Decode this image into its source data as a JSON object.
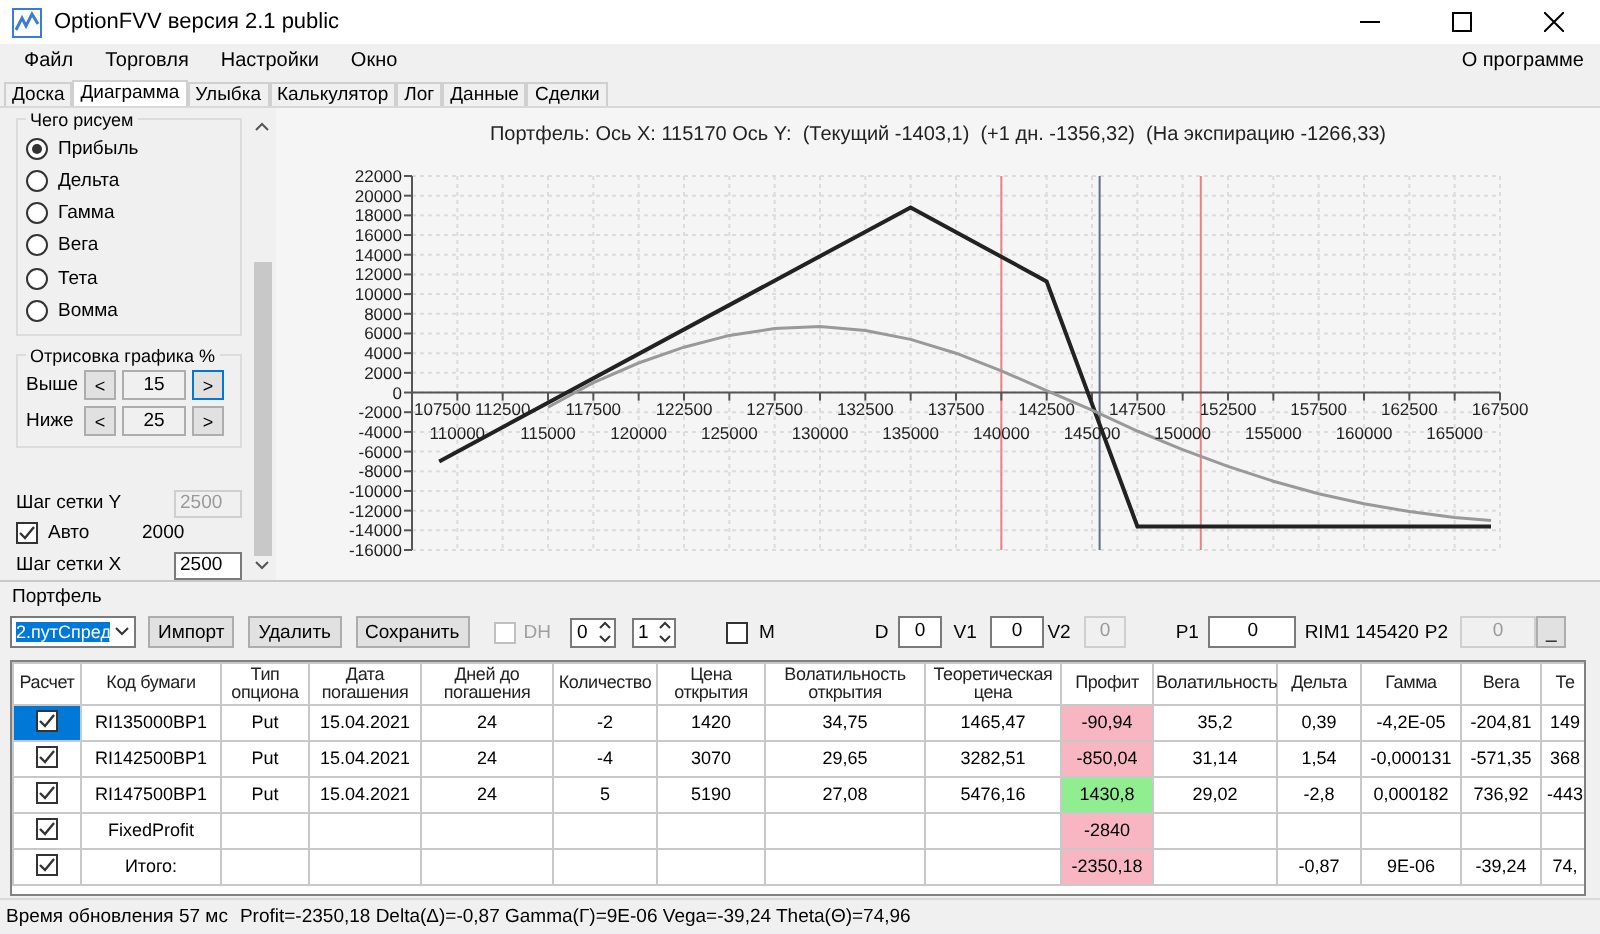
{
  "window": {
    "title": "OptionFVV версия 2.1 public"
  },
  "menu": [
    {
      "label": "Файл"
    },
    {
      "label": "Торговля"
    },
    {
      "label": "Настройки"
    },
    {
      "label": "Окно"
    }
  ],
  "menu_right": "О программе",
  "tabs": [
    {
      "label": "Доска",
      "selected": false
    },
    {
      "label": "Диаграмма",
      "selected": true
    },
    {
      "label": "Улыбка",
      "selected": false
    },
    {
      "label": "Калькулятор",
      "selected": false
    },
    {
      "label": "Лог",
      "selected": false
    },
    {
      "label": "Данные",
      "selected": false
    },
    {
      "label": "Сделки",
      "selected": false
    }
  ],
  "left_panel": {
    "draw_group": {
      "title": "Чего рисуем",
      "options": [
        {
          "label": "Прибыль",
          "selected": true
        },
        {
          "label": "Дельта",
          "selected": false
        },
        {
          "label": "Гамма",
          "selected": false
        },
        {
          "label": "Вега",
          "selected": false
        },
        {
          "label": "Тета",
          "selected": false
        },
        {
          "label": "Вомма",
          "selected": false
        }
      ]
    },
    "range_group": {
      "title": "Отрисовка графика %",
      "prev": "<",
      "next": ">",
      "rows": [
        {
          "label": "Выше",
          "value": "15",
          "next_focused": true
        },
        {
          "label": "Ниже",
          "value": "25",
          "next_focused": false
        }
      ]
    },
    "grid": {
      "y_label": "Шаг сетки Y",
      "y_value": "2500",
      "y_disabled": true,
      "auto_label": "Авто",
      "auto_checked": true,
      "auto_value": "2000",
      "x_label": "Шаг сетки X",
      "x_value": "2500"
    }
  },
  "chart": {
    "title": "Портфель: Ось X: 115170 Ось Y:  (Текущий -1403,1)  (+1 дн. -1356,32)  (На экспирацию -1266,33)",
    "chart_data": {
      "type": "line",
      "grid": true,
      "xlim": [
        107500,
        167500
      ],
      "ylim": [
        -16000,
        22000
      ],
      "xticks": [
        107500,
        112500,
        117500,
        122500,
        127500,
        132500,
        137500,
        142500,
        147500,
        152500,
        157500,
        162500,
        167500
      ],
      "yticks": [
        -16000,
        -14000,
        -12000,
        -10000,
        -8000,
        -6000,
        -4000,
        -2000,
        0,
        2000,
        4000,
        6000,
        8000,
        10000,
        12000,
        14000,
        16000,
        18000,
        20000,
        22000
      ],
      "series": [
        {
          "color": "#222222",
          "x": [
            109000,
            135000,
            142500,
            147500,
            167000
          ],
          "values": [
            -7000,
            18800,
            11300,
            -13600,
            -13600
          ]
        },
        {
          "color": "#999999",
          "x": [
            115000,
            117500,
            120000,
            122500,
            125000,
            127500,
            130000,
            132500,
            135000,
            137500,
            140000,
            142500,
            145000,
            147500,
            150000,
            152500,
            155000,
            157500,
            160000,
            162500,
            165000,
            167000
          ],
          "values": [
            -1500,
            1000,
            3000,
            4600,
            5800,
            6500,
            6700,
            6300,
            5400,
            4000,
            2200,
            200,
            -1800,
            -3900,
            -5800,
            -7500,
            -9000,
            -10300,
            -11300,
            -12100,
            -12700,
            -13000
          ]
        }
      ],
      "ref_lines": [
        {
          "axis": "x",
          "value": 140000,
          "color": "#f08080"
        },
        {
          "axis": "x",
          "value": 151000,
          "color": "#f08080"
        },
        {
          "axis": "x",
          "value": 145420,
          "color": "#607080"
        }
      ],
      "annotations": [
        "110000",
        "115000",
        "120000",
        "125000",
        "130000",
        "135000",
        "140000",
        "145000",
        "150000",
        "155000",
        "160000",
        "165000"
      ]
    }
  },
  "portfolio": {
    "title": "Портфель",
    "select": "2.путСпред",
    "buttons": [
      "Импорт",
      "Удалить",
      "Сохранить"
    ],
    "dh": {
      "label": "DH",
      "checked": false,
      "disabled": true
    },
    "spinners": [
      "0",
      "1"
    ],
    "m": {
      "label": "M",
      "checked": false
    },
    "fields": [
      {
        "label": "D",
        "value": "0",
        "disabled": false
      },
      {
        "label": "V1",
        "value": "0",
        "disabled": false
      },
      {
        "label": "V2",
        "value": "0",
        "disabled": true
      },
      {
        "label": "P1",
        "value": "0",
        "disabled": false
      },
      {
        "label": "P2",
        "value": "0",
        "disabled": true
      }
    ],
    "rim": "RIM1 145420",
    "small_button": "_",
    "columns": [
      "Расчет",
      "Код бумаги",
      "Тип опциона",
      "Дата погашения",
      "Дней до погашения",
      "Количество",
      "Цена открытия",
      "Волатильность открытия",
      "Теоретическая цена",
      "Профит",
      "Волатильность",
      "Дельта",
      "Гамма",
      "Вега",
      "Те"
    ],
    "rows": [
      {
        "checked": true,
        "selected": true,
        "code": "RI135000BP1",
        "type": "Put",
        "date": "15.04.2021",
        "days": "24",
        "qty": "-2",
        "price": "1420",
        "vol_open": "34,75",
        "theo": "1465,47",
        "profit": {
          "text": "-90,94",
          "color": "#f7b6c2"
        },
        "vol": "35,2",
        "delta": "0,39",
        "gamma": "-4,2E-05",
        "vega": "-204,81",
        "column_15": "149"
      },
      {
        "checked": true,
        "selected": false,
        "code": "RI142500BP1",
        "type": "Put",
        "date": "15.04.2021",
        "days": "24",
        "qty": "-4",
        "price": "3070",
        "vol_open": "29,65",
        "theo": "3282,51",
        "profit": {
          "text": "-850,04",
          "color": "#f7b6c2"
        },
        "vol": "31,14",
        "delta": "1,54",
        "gamma": "-0,000131",
        "vega": "-571,35",
        "column_15": "368"
      },
      {
        "checked": true,
        "selected": false,
        "code": "RI147500BP1",
        "type": "Put",
        "date": "15.04.2021",
        "days": "24",
        "qty": "5",
        "price": "5190",
        "vol_open": "27,08",
        "theo": "5476,16",
        "profit": {
          "text": "1430,8",
          "color": "#90ee90"
        },
        "vol": "29,02",
        "delta": "-2,8",
        "gamma": "0,000182",
        "vega": "736,92",
        "column_15": "-443"
      },
      {
        "checked": true,
        "selected": false,
        "code": "FixedProfit",
        "profit": {
          "text": "-2840",
          "color": "#f7b6c2"
        }
      },
      {
        "checked": true,
        "selected": false,
        "code": "Итого:",
        "profit": {
          "text": "-2350,18",
          "color": "#f7b6c2"
        },
        "delta": "-0,87",
        "gamma": "9E-06",
        "vega": "-39,24",
        "column_15": "74,"
      }
    ]
  },
  "status_bar": {
    "update": "Время обновления 57 мс",
    "stats": "Profit=-2350,18 Delta(Δ)=-0,87 Gamma(Γ)=9E-06 Vega=-39,24 Theta(Θ)=74,96"
  }
}
